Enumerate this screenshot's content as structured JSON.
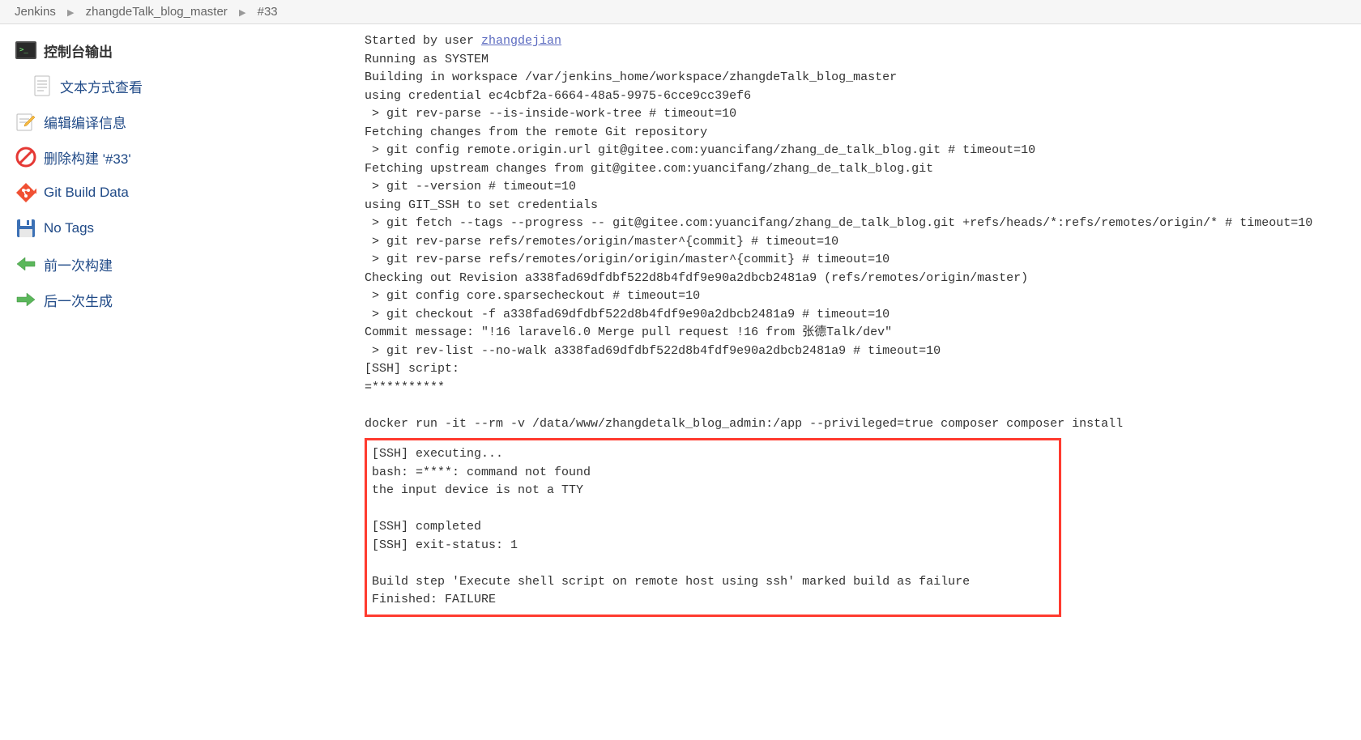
{
  "breadcrumb": {
    "items": [
      "Jenkins",
      "zhangdeTalk_blog_master",
      "#33"
    ]
  },
  "sidebar": {
    "items": [
      {
        "label": "控制台输出",
        "icon": "terminal-icon",
        "heading": true
      },
      {
        "label": "文本方式查看",
        "icon": "document-icon",
        "sub": true
      },
      {
        "label": "编辑编译信息",
        "icon": "edit-icon"
      },
      {
        "label": "删除构建 '#33'",
        "icon": "delete-icon"
      },
      {
        "label": "Git Build Data",
        "icon": "git-icon"
      },
      {
        "label": "No Tags",
        "icon": "save-icon"
      },
      {
        "label": "前一次构建",
        "icon": "arrow-left-icon"
      },
      {
        "label": "后一次生成",
        "icon": "arrow-right-icon"
      }
    ]
  },
  "console": {
    "line0": "Started by user ",
    "user_link": "zhangdejian",
    "lines": "\nRunning as SYSTEM\nBuilding in workspace /var/jenkins_home/workspace/zhangdeTalk_blog_master\nusing credential ec4cbf2a-6664-48a5-9975-6cce9cc39ef6\n > git rev-parse --is-inside-work-tree # timeout=10\nFetching changes from the remote Git repository\n > git config remote.origin.url git@gitee.com:yuancifang/zhang_de_talk_blog.git # timeout=10\nFetching upstream changes from git@gitee.com:yuancifang/zhang_de_talk_blog.git\n > git --version # timeout=10\nusing GIT_SSH to set credentials \n > git fetch --tags --progress -- git@gitee.com:yuancifang/zhang_de_talk_blog.git +refs/heads/*:refs/remotes/origin/* # timeout=10\n > git rev-parse refs/remotes/origin/master^{commit} # timeout=10\n > git rev-parse refs/remotes/origin/origin/master^{commit} # timeout=10\nChecking out Revision a338fad69dfdbf522d8b4fdf9e90a2dbcb2481a9 (refs/remotes/origin/master)\n > git config core.sparsecheckout # timeout=10\n > git checkout -f a338fad69dfdbf522d8b4fdf9e90a2dbcb2481a9 # timeout=10\nCommit message: \"!16 laravel6.0 Merge pull request !16 from 张德Talk/dev\"\n > git rev-list --no-walk a338fad69dfdbf522d8b4fdf9e90a2dbcb2481a9 # timeout=10\n[SSH] script:\n=**********\n\ndocker run -it --rm -v /data/www/zhangdetalk_blog_admin:/app --privileged=true composer composer install\n",
    "highlighted": "[SSH] executing...\nbash: =****: command not found\nthe input device is not a TTY\n\n[SSH] completed\n[SSH] exit-status: 1\n\nBuild step 'Execute shell script on remote host using ssh' marked build as failure\nFinished: FAILURE"
  }
}
